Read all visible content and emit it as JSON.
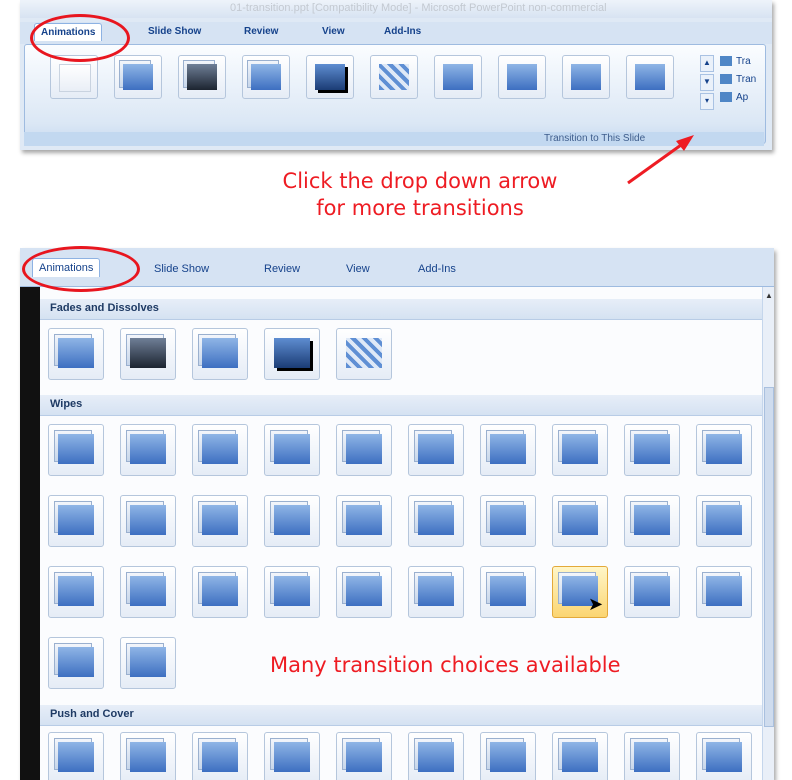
{
  "top_window": {
    "title": "01-transition.ppt [Compatibility Mode] - Microsoft PowerPoint non-commercial",
    "tabs": [
      "Animations",
      "Slide Show",
      "Review",
      "View",
      "Add-Ins"
    ],
    "group_label": "Transition to This Slide",
    "side_commands": [
      "Tra",
      "Tran",
      "Ap"
    ],
    "gallery_count": 10
  },
  "annotations": {
    "dropdown_note_line1": "Click the drop down arrow",
    "dropdown_note_line2": "for more transitions",
    "many_note": "Many transition choices available"
  },
  "gallery_window": {
    "tabs": [
      "Animations",
      "Slide Show",
      "Review",
      "View",
      "Add-Ins"
    ],
    "sections": [
      "Fades and Dissolves",
      "Wipes",
      "Push and Cover"
    ],
    "fades_count": 5,
    "wipes_count": 32,
    "push_count": 10,
    "selected_wipe_index": 27
  },
  "colors": {
    "annotation": "#ee1c23",
    "accent": "#3d6fc1"
  }
}
